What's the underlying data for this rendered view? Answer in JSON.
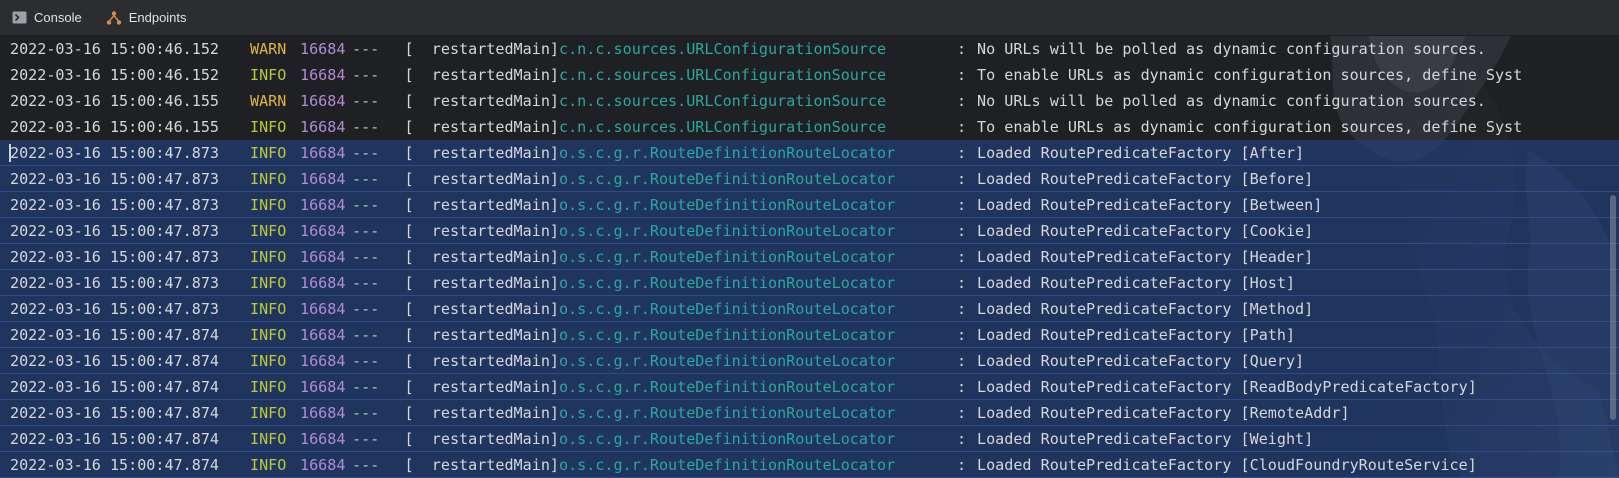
{
  "toolbar": {
    "tabs": [
      {
        "label": "Console",
        "icon": "console-icon"
      },
      {
        "label": "Endpoints",
        "icon": "endpoints-icon"
      }
    ]
  },
  "colors": {
    "warn": "#e3b341",
    "info": "#b9c93b",
    "pid": "#b48ad8",
    "logger": "#2aa7a0",
    "selection": "#214283"
  },
  "log": [
    {
      "date": "2022-03-16 15:00:46.152",
      "level": "WARN",
      "pid": "16684",
      "sep": "---",
      "thread": "[  restartedMain]",
      "logger": "c.n.c.sources.URLConfigurationSource",
      "colon": ":",
      "msg": "No URLs will be polled as dynamic configuration sources.",
      "selected": false
    },
    {
      "date": "2022-03-16 15:00:46.152",
      "level": "INFO",
      "pid": "16684",
      "sep": "---",
      "thread": "[  restartedMain]",
      "logger": "c.n.c.sources.URLConfigurationSource",
      "colon": ":",
      "msg": "To enable URLs as dynamic configuration sources, define Syst",
      "selected": false
    },
    {
      "date": "2022-03-16 15:00:46.155",
      "level": "WARN",
      "pid": "16684",
      "sep": "---",
      "thread": "[  restartedMain]",
      "logger": "c.n.c.sources.URLConfigurationSource",
      "colon": ":",
      "msg": "No URLs will be polled as dynamic configuration sources.",
      "selected": false
    },
    {
      "date": "2022-03-16 15:00:46.155",
      "level": "INFO",
      "pid": "16684",
      "sep": "---",
      "thread": "[  restartedMain]",
      "logger": "c.n.c.sources.URLConfigurationSource",
      "colon": ":",
      "msg": "To enable URLs as dynamic configuration sources, define Syst",
      "selected": false
    },
    {
      "date": "2022-03-16 15:00:47.873",
      "level": "INFO",
      "pid": "16684",
      "sep": "---",
      "thread": "[  restartedMain]",
      "logger": "o.s.c.g.r.RouteDefinitionRouteLocator",
      "colon": ":",
      "msg": "Loaded RoutePredicateFactory [After]",
      "selected": true,
      "caret": true
    },
    {
      "date": "2022-03-16 15:00:47.873",
      "level": "INFO",
      "pid": "16684",
      "sep": "---",
      "thread": "[  restartedMain]",
      "logger": "o.s.c.g.r.RouteDefinitionRouteLocator",
      "colon": ":",
      "msg": "Loaded RoutePredicateFactory [Before]",
      "selected": true
    },
    {
      "date": "2022-03-16 15:00:47.873",
      "level": "INFO",
      "pid": "16684",
      "sep": "---",
      "thread": "[  restartedMain]",
      "logger": "o.s.c.g.r.RouteDefinitionRouteLocator",
      "colon": ":",
      "msg": "Loaded RoutePredicateFactory [Between]",
      "selected": true
    },
    {
      "date": "2022-03-16 15:00:47.873",
      "level": "INFO",
      "pid": "16684",
      "sep": "---",
      "thread": "[  restartedMain]",
      "logger": "o.s.c.g.r.RouteDefinitionRouteLocator",
      "colon": ":",
      "msg": "Loaded RoutePredicateFactory [Cookie]",
      "selected": true
    },
    {
      "date": "2022-03-16 15:00:47.873",
      "level": "INFO",
      "pid": "16684",
      "sep": "---",
      "thread": "[  restartedMain]",
      "logger": "o.s.c.g.r.RouteDefinitionRouteLocator",
      "colon": ":",
      "msg": "Loaded RoutePredicateFactory [Header]",
      "selected": true
    },
    {
      "date": "2022-03-16 15:00:47.873",
      "level": "INFO",
      "pid": "16684",
      "sep": "---",
      "thread": "[  restartedMain]",
      "logger": "o.s.c.g.r.RouteDefinitionRouteLocator",
      "colon": ":",
      "msg": "Loaded RoutePredicateFactory [Host]",
      "selected": true
    },
    {
      "date": "2022-03-16 15:00:47.873",
      "level": "INFO",
      "pid": "16684",
      "sep": "---",
      "thread": "[  restartedMain]",
      "logger": "o.s.c.g.r.RouteDefinitionRouteLocator",
      "colon": ":",
      "msg": "Loaded RoutePredicateFactory [Method]",
      "selected": true
    },
    {
      "date": "2022-03-16 15:00:47.874",
      "level": "INFO",
      "pid": "16684",
      "sep": "---",
      "thread": "[  restartedMain]",
      "logger": "o.s.c.g.r.RouteDefinitionRouteLocator",
      "colon": ":",
      "msg": "Loaded RoutePredicateFactory [Path]",
      "selected": true
    },
    {
      "date": "2022-03-16 15:00:47.874",
      "level": "INFO",
      "pid": "16684",
      "sep": "---",
      "thread": "[  restartedMain]",
      "logger": "o.s.c.g.r.RouteDefinitionRouteLocator",
      "colon": ":",
      "msg": "Loaded RoutePredicateFactory [Query]",
      "selected": true
    },
    {
      "date": "2022-03-16 15:00:47.874",
      "level": "INFO",
      "pid": "16684",
      "sep": "---",
      "thread": "[  restartedMain]",
      "logger": "o.s.c.g.r.RouteDefinitionRouteLocator",
      "colon": ":",
      "msg": "Loaded RoutePredicateFactory [ReadBodyPredicateFactory]",
      "selected": true
    },
    {
      "date": "2022-03-16 15:00:47.874",
      "level": "INFO",
      "pid": "16684",
      "sep": "---",
      "thread": "[  restartedMain]",
      "logger": "o.s.c.g.r.RouteDefinitionRouteLocator",
      "colon": ":",
      "msg": "Loaded RoutePredicateFactory [RemoteAddr]",
      "selected": true
    },
    {
      "date": "2022-03-16 15:00:47.874",
      "level": "INFO",
      "pid": "16684",
      "sep": "---",
      "thread": "[  restartedMain]",
      "logger": "o.s.c.g.r.RouteDefinitionRouteLocator",
      "colon": ":",
      "msg": "Loaded RoutePredicateFactory [Weight]",
      "selected": true
    },
    {
      "date": "2022-03-16 15:00:47.874",
      "level": "INFO",
      "pid": "16684",
      "sep": "---",
      "thread": "[  restartedMain]",
      "logger": "o.s.c.g.r.RouteDefinitionRouteLocator",
      "colon": ":",
      "msg": "Loaded RoutePredicateFactory [CloudFoundryRouteService]",
      "selected": true
    }
  ]
}
